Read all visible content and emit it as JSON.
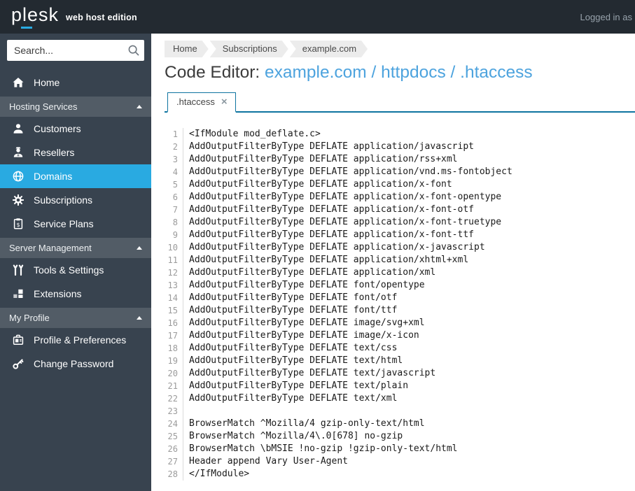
{
  "topbar": {
    "logo": "plesk",
    "edition": "web host edition",
    "logged_in": "Logged in as"
  },
  "sidebar": {
    "search_placeholder": "Search...",
    "home": {
      "label": "Home",
      "icon": "home-icon"
    },
    "sections": [
      {
        "label": "Hosting Services",
        "items": [
          {
            "label": "Customers",
            "icon": "customers-icon",
            "selected": false
          },
          {
            "label": "Resellers",
            "icon": "resellers-icon",
            "selected": false
          },
          {
            "label": "Domains",
            "icon": "globe-icon",
            "selected": true
          },
          {
            "label": "Subscriptions",
            "icon": "gear-icon",
            "selected": false
          },
          {
            "label": "Service Plans",
            "icon": "service-plans-icon",
            "selected": false
          }
        ]
      },
      {
        "label": "Server Management",
        "items": [
          {
            "label": "Tools & Settings",
            "icon": "tools-icon",
            "selected": false
          },
          {
            "label": "Extensions",
            "icon": "extensions-icon",
            "selected": false
          }
        ]
      },
      {
        "label": "My Profile",
        "items": [
          {
            "label": "Profile & Preferences",
            "icon": "id-card-icon",
            "selected": false
          },
          {
            "label": "Change Password",
            "icon": "key-icon",
            "selected": false
          }
        ]
      }
    ]
  },
  "breadcrumb": {
    "items": [
      "Home",
      "Subscriptions",
      "example.com"
    ]
  },
  "page": {
    "title_prefix": "Code Editor: ",
    "title_path": "example.com / httpdocs / .htaccess"
  },
  "editor": {
    "tab_label": ".htaccess",
    "close_glyph": "×",
    "lines": [
      "<IfModule mod_deflate.c>",
      "AddOutputFilterByType DEFLATE application/javascript",
      "AddOutputFilterByType DEFLATE application/rss+xml",
      "AddOutputFilterByType DEFLATE application/vnd.ms-fontobject",
      "AddOutputFilterByType DEFLATE application/x-font",
      "AddOutputFilterByType DEFLATE application/x-font-opentype",
      "AddOutputFilterByType DEFLATE application/x-font-otf",
      "AddOutputFilterByType DEFLATE application/x-font-truetype",
      "AddOutputFilterByType DEFLATE application/x-font-ttf",
      "AddOutputFilterByType DEFLATE application/x-javascript",
      "AddOutputFilterByType DEFLATE application/xhtml+xml",
      "AddOutputFilterByType DEFLATE application/xml",
      "AddOutputFilterByType DEFLATE font/opentype",
      "AddOutputFilterByType DEFLATE font/otf",
      "AddOutputFilterByType DEFLATE font/ttf",
      "AddOutputFilterByType DEFLATE image/svg+xml",
      "AddOutputFilterByType DEFLATE image/x-icon",
      "AddOutputFilterByType DEFLATE text/css",
      "AddOutputFilterByType DEFLATE text/html",
      "AddOutputFilterByType DEFLATE text/javascript",
      "AddOutputFilterByType DEFLATE text/plain",
      "AddOutputFilterByType DEFLATE text/xml",
      "",
      "BrowserMatch ^Mozilla/4 gzip-only-text/html",
      "BrowserMatch ^Mozilla/4\\.0[678] no-gzip",
      "BrowserMatch \\bMSIE !no-gzip !gzip-only-text/html",
      "Header append Vary User-Agent",
      "</IfModule>"
    ]
  },
  "colors": {
    "topbar_bg": "#232a31",
    "sidebar_bg": "#38434f",
    "section_header_bg": "#525c66",
    "accent_selected": "#29aae1",
    "tab_border": "#0e74a0",
    "title_link": "#4da3de",
    "breadcrumb_bg": "#ececec"
  }
}
